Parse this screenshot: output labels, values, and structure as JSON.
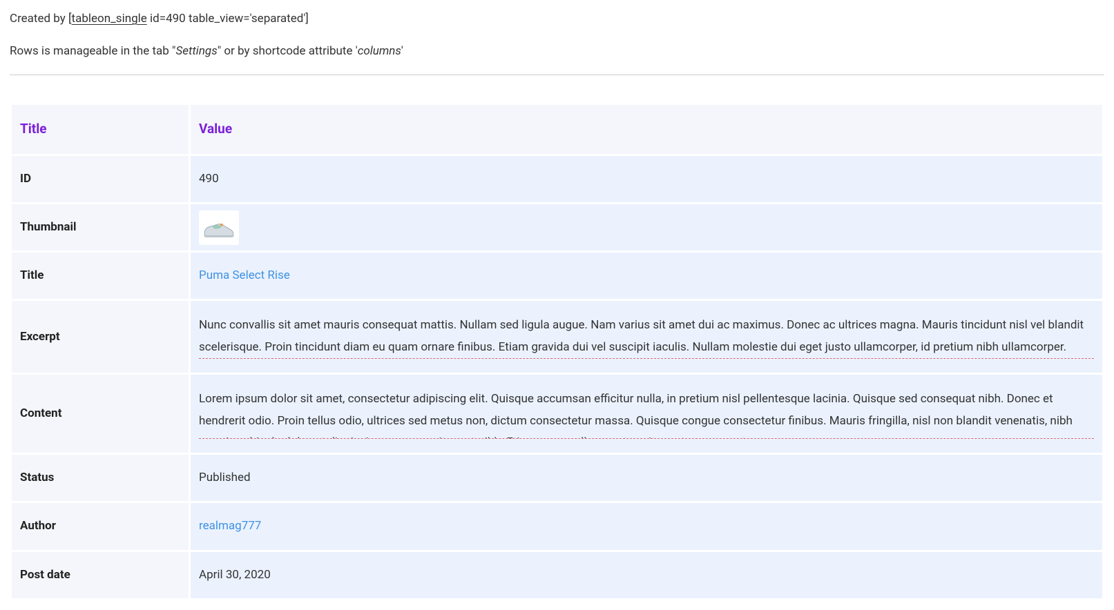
{
  "intro": {
    "line1_prefix": "Created by [",
    "line1_shortcode": "tableon_single",
    "line1_suffix": " id=490 table_view='separated']",
    "line2_a": "Rows is manageable in the tab \"",
    "line2_settings": "Settings",
    "line2_b": "\" or by shortcode attribute '",
    "line2_columns": "columns",
    "line2_c": "'"
  },
  "headers": {
    "title": "Title",
    "value": "Value"
  },
  "rows": {
    "id_label": "ID",
    "id_value": "490",
    "thumb_label": "Thumbnail",
    "title_label": "Title",
    "title_value": "Puma Select Rise",
    "excerpt_label": "Excerpt",
    "excerpt_value": "Nunc convallis sit amet mauris consequat mattis. Nullam sed ligula augue. Nam varius sit amet dui ac maximus. Donec ac ultrices magna. Mauris tincidunt nisl vel blandit scelerisque. Proin tincidunt diam eu quam ornare finibus. Etiam gravida dui vel suscipit iaculis. Nullam molestie dui eget justo ullamcorper, id pretium nibh ullamcorper.",
    "content_label": "Content",
    "content_value": "Lorem ipsum dolor sit amet, consectetur adipiscing elit. Quisque accumsan efficitur nulla, in pretium nisl pellentesque lacinia. Quisque sed consequat nibh. Donec et hendrerit odio. Proin tellus odio, ultrices sed metus non, dictum consectetur massa. Quisque congue consectetur finibus. Mauris fringilla, nisl non blandit venenatis, nibh mauris vehicula dolor, et dignissim sem sem sit amet nibh. Etiam nunc nulla, egestas sit amet neque eget.",
    "status_label": "Status",
    "status_value": "Published",
    "author_label": "Author",
    "author_value": "realmag777",
    "postdate_label": "Post date",
    "postdate_value": "April 30, 2020"
  }
}
